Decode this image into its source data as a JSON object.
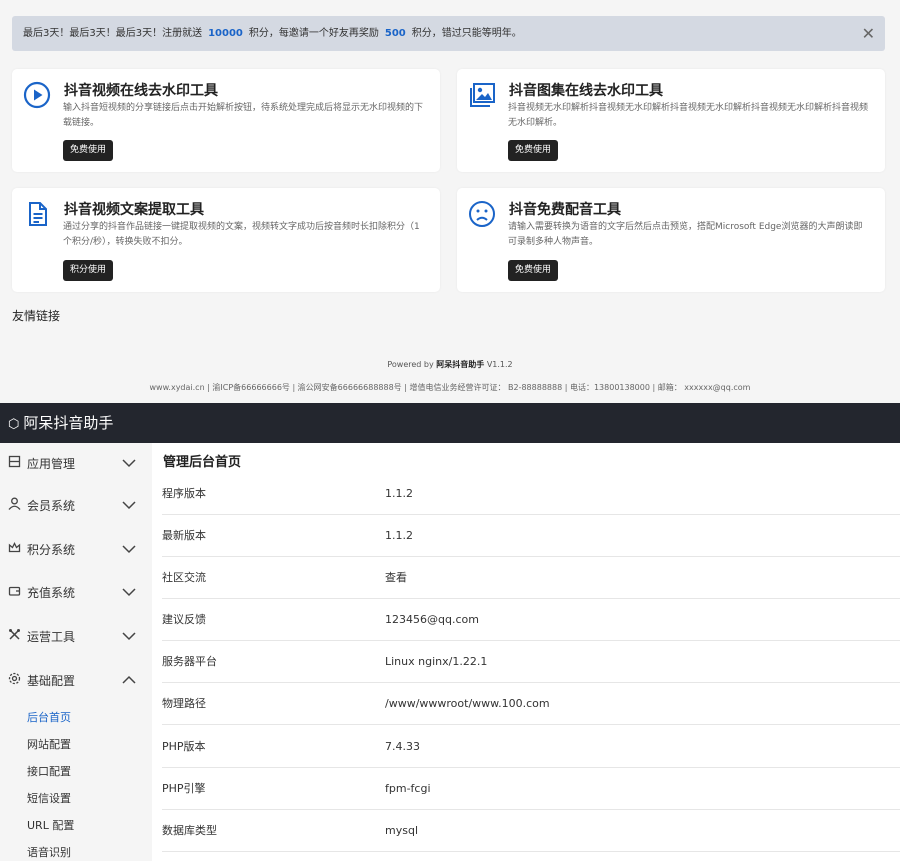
{
  "notice": {
    "part1": "最后3天！最后3天！最后3天！注册就送",
    "num1": "10000",
    "part2": "积分，每邀请一个好友再奖励",
    "num2": "500",
    "part3": "积分，错过只能等明年。",
    "close_icon": "close-icon"
  },
  "tools": [
    {
      "title": "抖音视频在线去水印工具",
      "desc": "输入抖音短视频的分享链接后点击开始解析按钮，待系统处理完成后将显示无水印视频的下载链接。",
      "button": "免费使用",
      "icon": "play-circle-icon"
    },
    {
      "title": "抖音图集在线去水印工具",
      "desc": "抖音视频无水印解析抖音视频无水印解析抖音视频无水印解析抖音视频无水印解析抖音视频无水印解析。",
      "button": "免费使用",
      "icon": "image-gallery-icon"
    },
    {
      "title": "抖音视频文案提取工具",
      "desc": "通过分享的抖音作品链接一键提取视频的文案，视频转文字成功后按音频时长扣除积分（1个积分/秒），转换失败不扣分。",
      "button": "积分使用",
      "icon": "document-icon"
    },
    {
      "title": "抖音免费配音工具",
      "desc": "请输入需要转换为语音的文字后然后点击预览，搭配Microsoft Edge浏览器的大声朗读即可录制多种人物声音。",
      "button": "免费使用",
      "icon": "frown-face-icon"
    }
  ],
  "friend_links_label": "友情链接",
  "powered": {
    "prefix": "Powered by",
    "name": "阿呆抖音助手",
    "version": "V1.1.2"
  },
  "footer": "www.xydai.cn | 渝ICP备66666666号 | 渝公网安备66666688888号 | 增值电信业务经营许可证： B2-88888888 | 电话：13800138000 | 邮箱： xxxxxx@qq.com",
  "admin": {
    "app_title": "阿呆抖音助手",
    "sidebar": [
      {
        "label": "应用管理",
        "icon": "grid-icon",
        "expanded": false
      },
      {
        "label": "会员系统",
        "icon": "user-icon",
        "expanded": false
      },
      {
        "label": "积分系统",
        "icon": "crown-icon",
        "expanded": false
      },
      {
        "label": "充值系统",
        "icon": "wallet-icon",
        "expanded": false
      },
      {
        "label": "运营工具",
        "icon": "tools-icon",
        "expanded": false
      },
      {
        "label": "基础配置",
        "icon": "gear-icon",
        "expanded": true
      }
    ],
    "submenu": [
      "后台首页",
      "网站配置",
      "接口配置",
      "短信设置",
      "URL 配置",
      "语音识别"
    ],
    "active_submenu": "后台首页",
    "page_title": "管理后台首页",
    "info": [
      {
        "key": "程序版本",
        "value": "1.1.2"
      },
      {
        "key": "最新版本",
        "value": "1.1.2"
      },
      {
        "key": "社区交流",
        "value": "查看"
      },
      {
        "key": "建议反馈",
        "value": "123456@qq.com"
      },
      {
        "key": "服务器平台",
        "value": "Linux nginx/1.22.1"
      },
      {
        "key": "物理路径",
        "value": "/www/wwwroot/www.100.com"
      },
      {
        "key": "PHP版本",
        "value": "7.4.33"
      },
      {
        "key": "PHP引擎",
        "value": "fpm-fcgi"
      },
      {
        "key": "数据库类型",
        "value": "mysql"
      }
    ]
  }
}
